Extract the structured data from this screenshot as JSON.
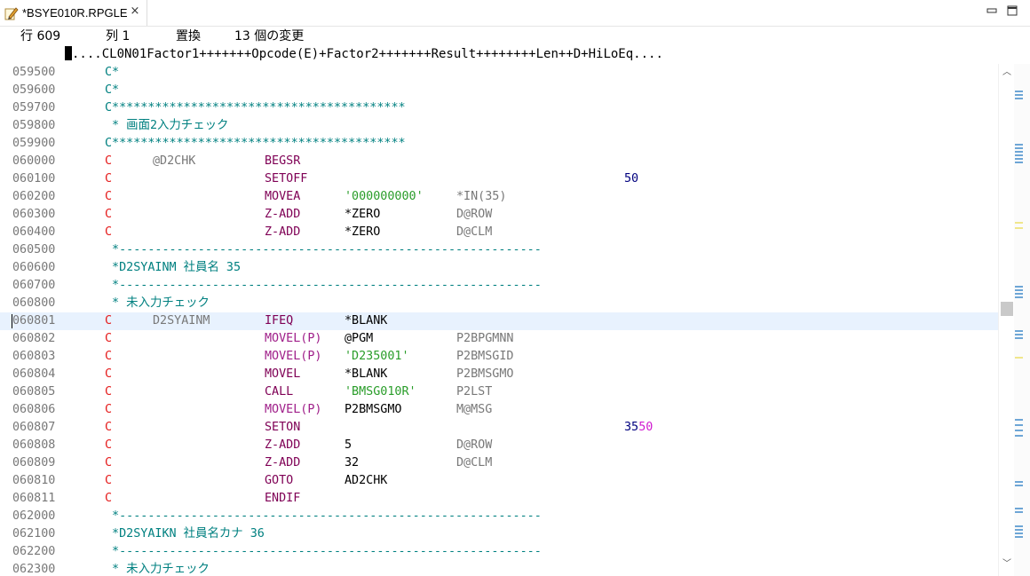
{
  "tab": {
    "title": "*BSYE010R.RPGLE",
    "close_glyph": "×"
  },
  "window": {
    "minimize_glyph": "—",
    "maximize_glyph": "□"
  },
  "status": {
    "line": "行 609",
    "column": "列 1",
    "mode": "置換",
    "changes": "13 個の変更"
  },
  "ruler": {
    "text": "....CL0N01Factor1+++++++Opcode(E)+Factor2+++++++Result++++++++Len++D+HiLoEq...."
  },
  "lines": [
    {
      "n": "059500",
      "kind": "comment",
      "text": "C*"
    },
    {
      "n": "059600",
      "kind": "comment",
      "text": "C*"
    },
    {
      "n": "059700",
      "kind": "comment",
      "text": "C*****************************************"
    },
    {
      "n": "059800",
      "kind": "comment",
      "text": " * 画面2入力チェック"
    },
    {
      "n": "059900",
      "kind": "comment",
      "text": "C*****************************************"
    },
    {
      "n": "060000",
      "kind": "calc",
      "f1": "@D2CHK",
      "op": "BEGSR",
      "f2": "",
      "res": "",
      "ind": ""
    },
    {
      "n": "060100",
      "kind": "calc",
      "f1": "",
      "op": "SETOFF",
      "f2": "",
      "res": "",
      "ind": "50"
    },
    {
      "n": "060200",
      "kind": "calc",
      "f1": "",
      "op": "MOVEA",
      "f2": "'000000000'",
      "lit": true,
      "res": "*IN(35)",
      "ind": ""
    },
    {
      "n": "060300",
      "kind": "calc",
      "f1": "",
      "op": "Z-ADD",
      "f2": "*ZERO",
      "res": "D@ROW",
      "ind": ""
    },
    {
      "n": "060400",
      "kind": "calc",
      "f1": "",
      "op": "Z-ADD",
      "f2": "*ZERO",
      "res": "D@CLM",
      "ind": ""
    },
    {
      "n": "060500",
      "kind": "comment",
      "text": " *-----------------------------------------------------------"
    },
    {
      "n": "060600",
      "kind": "comment",
      "text": " *D2SYAINM 社員名 35"
    },
    {
      "n": "060700",
      "kind": "comment",
      "text": " *-----------------------------------------------------------"
    },
    {
      "n": "060800",
      "kind": "comment",
      "text": " * 未入力チェック"
    },
    {
      "n": "060801",
      "kind": "calc",
      "current": true,
      "f1": "D2SYAINM",
      "op": "IFEQ",
      "f2": "*BLANK",
      "res": "",
      "ind": ""
    },
    {
      "n": "060802",
      "kind": "calc",
      "f1": "",
      "op": "MOVEL(P)",
      "op2": true,
      "f2": "@PGM",
      "res": "P2BPGMNN",
      "ind": ""
    },
    {
      "n": "060803",
      "kind": "calc",
      "f1": "",
      "op": "MOVEL(P)",
      "op2": true,
      "f2": "'D235001'",
      "lit": true,
      "res": "P2BMSGID",
      "ind": ""
    },
    {
      "n": "060804",
      "kind": "calc",
      "f1": "",
      "op": "MOVEL",
      "f2": "*BLANK",
      "res": "P2BMSGMO",
      "ind": ""
    },
    {
      "n": "060805",
      "kind": "calc",
      "f1": "",
      "op": "CALL",
      "f2": "'BMSG010R'",
      "lit": true,
      "res": "P2LST",
      "ind": ""
    },
    {
      "n": "060806",
      "kind": "calc",
      "f1": "",
      "op": "MOVEL(P)",
      "op2": true,
      "f2": "P2BMSGMO",
      "res": "M@MSG",
      "ind": ""
    },
    {
      "n": "060807",
      "kind": "calc",
      "f1": "",
      "op": "SETON",
      "f2": "",
      "res": "",
      "ind": "35",
      "ind2": "50"
    },
    {
      "n": "060808",
      "kind": "calc",
      "f1": "",
      "op": "Z-ADD",
      "f2": "5",
      "res": "D@ROW",
      "ind": ""
    },
    {
      "n": "060809",
      "kind": "calc",
      "f1": "",
      "op": "Z-ADD",
      "f2": "32",
      "res": "D@CLM",
      "ind": ""
    },
    {
      "n": "060810",
      "kind": "calc",
      "f1": "",
      "op": "GOTO",
      "f2": "AD2CHK",
      "res": "",
      "ind": ""
    },
    {
      "n": "060811",
      "kind": "calc",
      "f1": "",
      "op": "ENDIF",
      "f2": "",
      "res": "",
      "ind": ""
    },
    {
      "n": "062000",
      "kind": "comment",
      "text": " *-----------------------------------------------------------"
    },
    {
      "n": "062100",
      "kind": "comment",
      "text": " *D2SYAIKN 社員名カナ 36"
    },
    {
      "n": "062200",
      "kind": "comment",
      "text": " *-----------------------------------------------------------"
    },
    {
      "n": "062300",
      "kind": "comment",
      "text": " * 未入力チェック"
    }
  ],
  "scrollbar": {
    "up_glyph": "︿",
    "down_glyph": "﹀"
  },
  "colors": {
    "c_spec": "#e51c1c",
    "comment": "#008080",
    "opcode": "#7f0055",
    "literal": "#2a9d2a",
    "current_line": "#e8f2fe"
  }
}
